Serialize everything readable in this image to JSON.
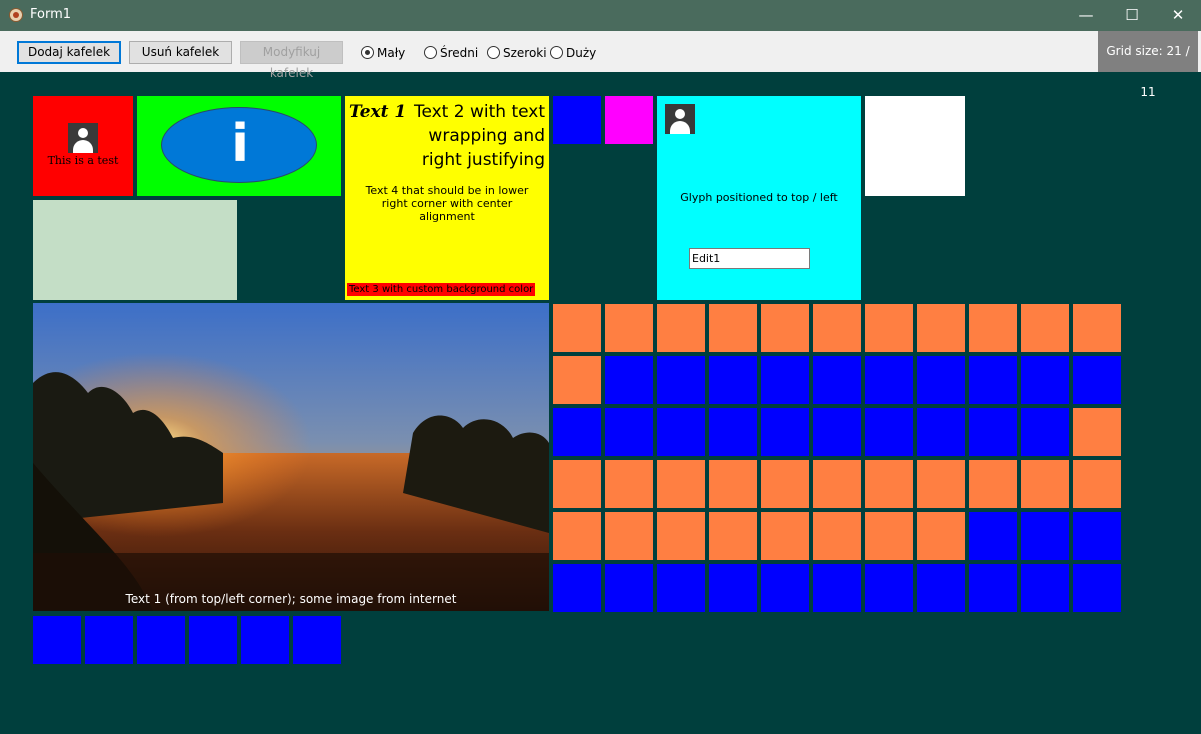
{
  "window": {
    "title": "Form1",
    "minimize_glyph": "—",
    "maximize_glyph": "☐",
    "close_glyph": "✕"
  },
  "toolbar": {
    "add_label": "Dodaj kafelek",
    "remove_label": "Usuń kafelek",
    "modify_label": "Modyfikuj kafelek",
    "sizes": [
      {
        "label": "Mały",
        "checked": true
      },
      {
        "label": "Średni",
        "checked": false
      },
      {
        "label": "Szeroki",
        "checked": false
      },
      {
        "label": "Duży",
        "checked": false
      }
    ],
    "grid_size": "Grid size: 21 / 11"
  },
  "tiles": {
    "red_tile": {
      "label": "This is a test",
      "color": "#ff0000"
    },
    "green_tile": {
      "glyph": "i",
      "color": "#00ff00"
    },
    "yellow_tile": {
      "text1": "Text 1",
      "text2": "Text 2 with text wrapping and right justifying",
      "text3": "Text 3 with custom background color",
      "text4": "Text 4 that should be in lower right corner with center alignment",
      "color": "#ffff00"
    },
    "cyan_tile": {
      "text": "Glyph positioned to top / left",
      "edit_value": "Edit1",
      "color": "#00ffff"
    },
    "image_tile": {
      "caption": "Text 1 (from top/left corner); some image from internet"
    },
    "colors": {
      "orange": "#ff7f42",
      "blue": "#0000ff",
      "magenta": "#ff00ff",
      "white": "#ffffff",
      "sage": "#c4dec6"
    }
  }
}
